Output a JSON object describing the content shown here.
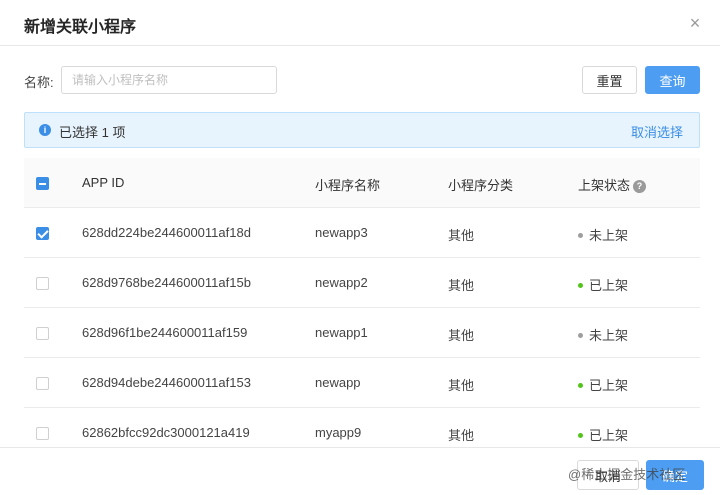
{
  "dialog": {
    "title": "新增关联小程序",
    "close_icon": "×"
  },
  "search": {
    "label": "名称:",
    "placeholder": "请输入小程序名称",
    "value": "",
    "reset_label": "重置",
    "query_label": "查询"
  },
  "alert": {
    "icon": "i",
    "text": "已选择 1 项",
    "link": "取消选择"
  },
  "table": {
    "columns": [
      "APP ID",
      "小程序名称",
      "小程序分类",
      "上架状态"
    ],
    "help_icon": "?",
    "rows": [
      {
        "checked": true,
        "app_id": "628dd224be244600011af18d",
        "name": "newapp3",
        "category": "其他",
        "status": "未上架",
        "status_color": "#9e9e9e"
      },
      {
        "checked": false,
        "app_id": "628d9768be244600011af15b",
        "name": "newapp2",
        "category": "其他",
        "status": "已上架",
        "status_color": "#52c41a"
      },
      {
        "checked": false,
        "app_id": "628d96f1be244600011af159",
        "name": "newapp1",
        "category": "其他",
        "status": "未上架",
        "status_color": "#9e9e9e"
      },
      {
        "checked": false,
        "app_id": "628d94debe244600011af153",
        "name": "newapp",
        "category": "其他",
        "status": "已上架",
        "status_color": "#52c41a"
      },
      {
        "checked": false,
        "app_id": "62862bfcc92dc3000121a419",
        "name": "myapp9",
        "category": "其他",
        "status": "已上架",
        "status_color": "#52c41a"
      }
    ]
  },
  "footer": {
    "cancel_label": "取消",
    "ok_label": "确定",
    "watermark": "@稀土掘金技术社区"
  },
  "colors": {
    "primary": "#4d9ef2",
    "link": "#3a8ee6",
    "alert_bg": "#e8f4fd"
  }
}
